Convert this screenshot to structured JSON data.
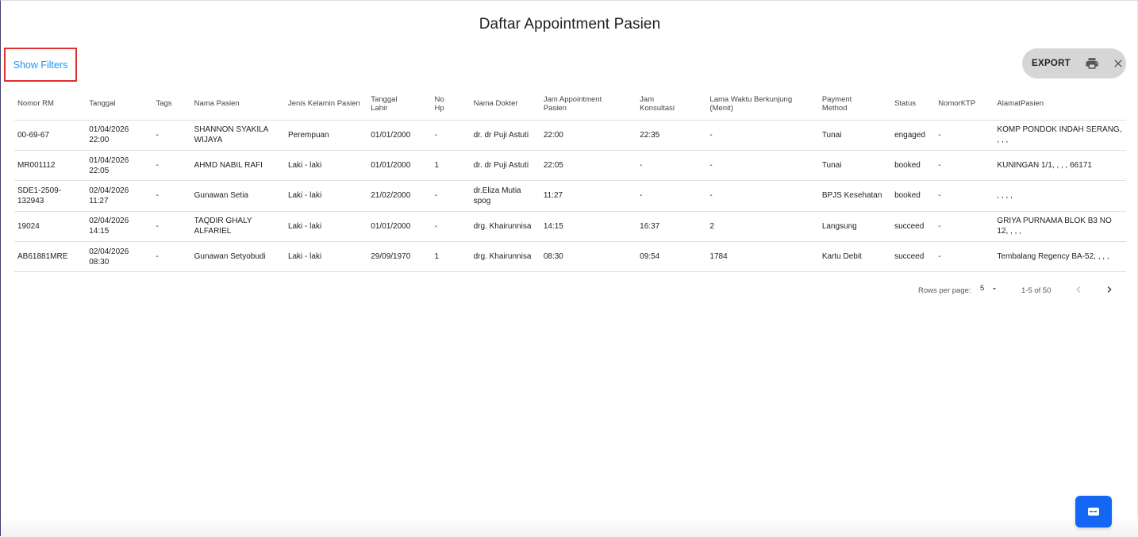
{
  "page": {
    "title": "Daftar Appointment Pasien"
  },
  "filters": {
    "show_label": "Show Filters"
  },
  "toolbar": {
    "export_label": "EXPORT",
    "print_icon": "print-icon",
    "close_icon": "close-icon"
  },
  "table": {
    "columns": [
      "Nomor RM",
      "Tanggal",
      "Tags",
      "Nama Pasien",
      "Jenis Kelamin Pasien",
      "Tanggal Lahir",
      "No Hp",
      "Nama Dokter",
      "Jam Appointment Pasien",
      "Jam Konsultasi",
      "Lama Waktu Berkunjung (Menit)",
      "Payment Method",
      "Status",
      "NomorKTP",
      "AlamatPasien"
    ],
    "rows": [
      [
        "00-69-67",
        "01/04/2026 22:00",
        "-",
        "SHANNON SYAKILA WIJAYA",
        "Perempuan",
        "01/01/2000",
        "-",
        "dr. dr Puji Astuti",
        "22:00",
        "22:35",
        "-",
        "Tunai",
        "engaged",
        "-",
        "KOMP PONDOK INDAH SERANG, , , ,"
      ],
      [
        "MR001112",
        "01/04/2026 22:05",
        "-",
        "AHMD NABIL RAFI",
        "Laki - laki",
        "01/01/2000",
        "1",
        "dr. dr Puji Astuti",
        "22:05",
        "-",
        "-",
        "Tunai",
        "booked",
        "-",
        "KUNINGAN 1/1, , , , 66171"
      ],
      [
        "SDE1-2509-132943",
        "02/04/2026 11:27",
        "-",
        "Gunawan Setia",
        "Laki - laki",
        "21/02/2000",
        "-",
        "dr.Eliza Mutia spog",
        "11:27",
        "-",
        "-",
        "BPJS Kesehatan",
        "booked",
        "-",
        ", , , ,"
      ],
      [
        "19024",
        "02/04/2026 14:15",
        "-",
        "TAQDIR GHALY ALFARIEL",
        "Laki - laki",
        "01/01/2000",
        "-",
        "drg. Khairunnisa",
        "14:15",
        "16:37",
        "2",
        "Langsung",
        "succeed",
        "-",
        "GRIYA PURNAMA BLOK B3 NO 12, , , ,"
      ],
      [
        "AB61881MRE",
        "02/04/2026 08:30",
        "-",
        "Gunawan Setyobudi",
        "Laki - laki",
        "29/09/1970",
        "1",
        "drg. Khairunnisa",
        "08:30",
        "09:54",
        "1784",
        "Kartu Debit",
        "succeed",
        "-",
        "Tembalang Regency BA-52, , , ,"
      ]
    ]
  },
  "pagination": {
    "rows_per_page_label": "Rows per page:",
    "rows_per_page_value": "5",
    "range_label": "1-5 of 50"
  },
  "chat": {
    "icon": "chat-icon"
  },
  "colors": {
    "link": "#2196f3",
    "highlight_border": "#e03131",
    "fab": "#1466f5",
    "toolbar_bg": "#d6d6d6"
  }
}
